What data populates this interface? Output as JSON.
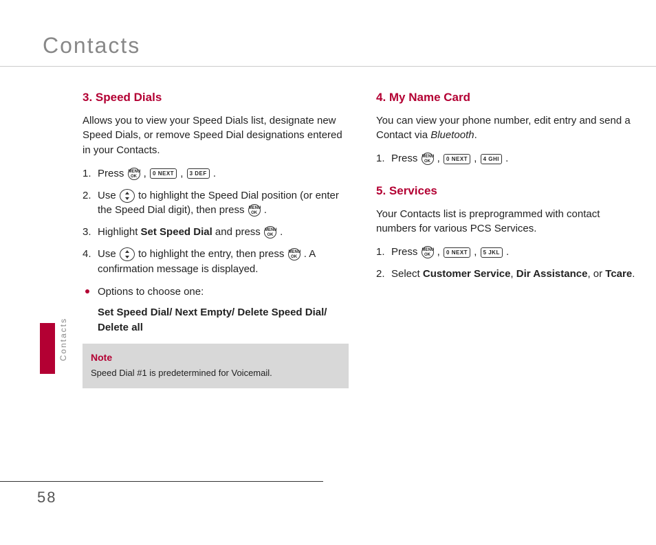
{
  "page": {
    "title": "Contacts",
    "side_label": "Contacts",
    "number": "58"
  },
  "left": {
    "h1": "3. Speed Dials",
    "p1": "Allows you to view your Speed Dials list, designate new Speed Dials, or remove Speed Dial designations entered in your Contacts.",
    "s1_pre": "Press ",
    "s2_a": "Use ",
    "s2_b": " to highlight the Speed Dial position (or enter the Speed Dial digit), then press ",
    "s3_a": "Highlight ",
    "s3_bold": "Set Speed Dial",
    "s3_b": " and press ",
    "s4_a": "Use ",
    "s4_b": " to highlight the entry, then press ",
    "s4_c": ". A confirmation message is displayed.",
    "bullet": "Options to choose one:",
    "options": "Set Speed Dial/ Next Empty/ Delete Speed Dial/ Delete all",
    "note_head": "Note",
    "note_body": "Speed Dial #1 is predetermined for Voicemail."
  },
  "right": {
    "h2": "4. My Name Card",
    "p2a": "You can view your phone number, edit entry and send a Contact via ",
    "p2b": "Bluetooth",
    "p2c": ".",
    "r1_pre": "Press ",
    "h3": "5. Services",
    "p3": "Your Contacts list is preprogrammed with contact numbers for various PCS Services.",
    "r2_pre": "Press ",
    "r3_a": "Select ",
    "r3_cs": "Customer Service",
    "r3_da": "Dir Assistance",
    "r3_or": ", or ",
    "r3_tc": "Tcare",
    "r3_end": "."
  },
  "keys": {
    "ok_top": "MENU",
    "ok_bot": "OK",
    "k0": "0 NEXT",
    "k3": "3 DEF",
    "k4": "4 GHI",
    "k5": "5 JKL"
  }
}
